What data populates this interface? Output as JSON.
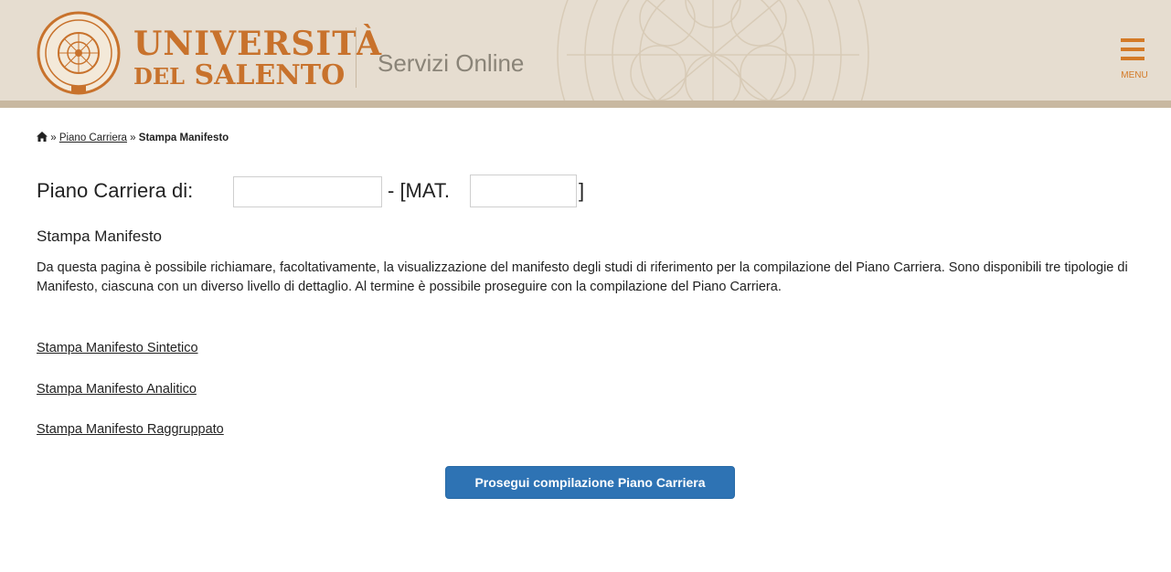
{
  "header": {
    "logo_line1": "UNIVERSITÀ",
    "logo_line2_prefix": "DEL",
    "logo_line2_main": "SALENTO",
    "site_name": "Servizi Online",
    "menu_label": "MENU"
  },
  "breadcrumb": {
    "separator": "»",
    "items": [
      {
        "label": "Piano Carriera"
      },
      {
        "label": "Stampa Manifesto"
      }
    ]
  },
  "title": {
    "prefix": "Piano Carriera di:",
    "middle": "- [MAT.",
    "suffix": "]"
  },
  "section": {
    "title": "Stampa Manifesto",
    "description": "Da questa pagina è possibile richiamare, facoltativamente, la visualizzazione del manifesto degli studi di riferimento per la compilazione del Piano Carriera. Sono disponibili tre tipologie di Manifesto, ciascuna con un diverso livello di dettaglio. Al termine è possibile proseguire con la compilazione del Piano Carriera."
  },
  "links": [
    {
      "label": "Stampa Manifesto Sintetico"
    },
    {
      "label": "Stampa Manifesto Analitico"
    },
    {
      "label": "Stampa Manifesto Raggruppato"
    }
  ],
  "actions": {
    "continue_label": "Prosegui compilazione Piano Carriera"
  },
  "colors": {
    "header_bg": "#e6ddd0",
    "brand_orange": "#c8722c",
    "primary_button": "#2e73b4"
  }
}
